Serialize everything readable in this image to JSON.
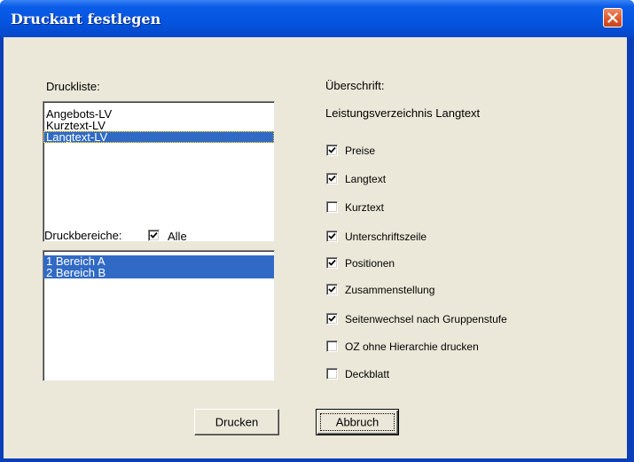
{
  "window": {
    "title": "Druckart festlegen",
    "close_icon": "close-icon"
  },
  "left": {
    "druckliste_label": "Druckliste:",
    "druckliste_items": [
      {
        "label": "Angebots-LV",
        "selected": false
      },
      {
        "label": "Kurztext-LV",
        "selected": false
      },
      {
        "label": "Langtext-LV",
        "selected": true
      }
    ],
    "druckbereiche_label": "Druckbereiche:",
    "alle_label": "Alle",
    "alle_checked": true,
    "druckbereiche_items": [
      {
        "label": "1 Bereich A",
        "selected": true
      },
      {
        "label": "2 Bereich B",
        "selected": true
      }
    ]
  },
  "right": {
    "ueberschrift_label": "Überschrift:",
    "ueberschrift_value": "Leistungsverzeichnis Langtext",
    "options": [
      {
        "label": "Preise",
        "checked": true
      },
      {
        "label": "Langtext",
        "checked": true
      },
      {
        "label": "Kurztext",
        "checked": false
      },
      {
        "label": "Unterschriftszeile",
        "checked": true
      },
      {
        "label": "Positionen",
        "checked": true
      },
      {
        "label": "Zusammenstellung",
        "checked": true
      },
      {
        "label": "Seitenwechsel nach Gruppenstufe",
        "checked": true
      },
      {
        "label": "OZ ohne Hierarchie drucken",
        "checked": false
      },
      {
        "label": "Deckblatt",
        "checked": false
      }
    ]
  },
  "buttons": {
    "print_label": "Drucken",
    "cancel_label": "Abbruch"
  },
  "colors": {
    "titlebar": "#0554df",
    "dialog_bg": "#ece8d9",
    "selection": "#316ac5",
    "close_button": "#dd5a2f"
  }
}
